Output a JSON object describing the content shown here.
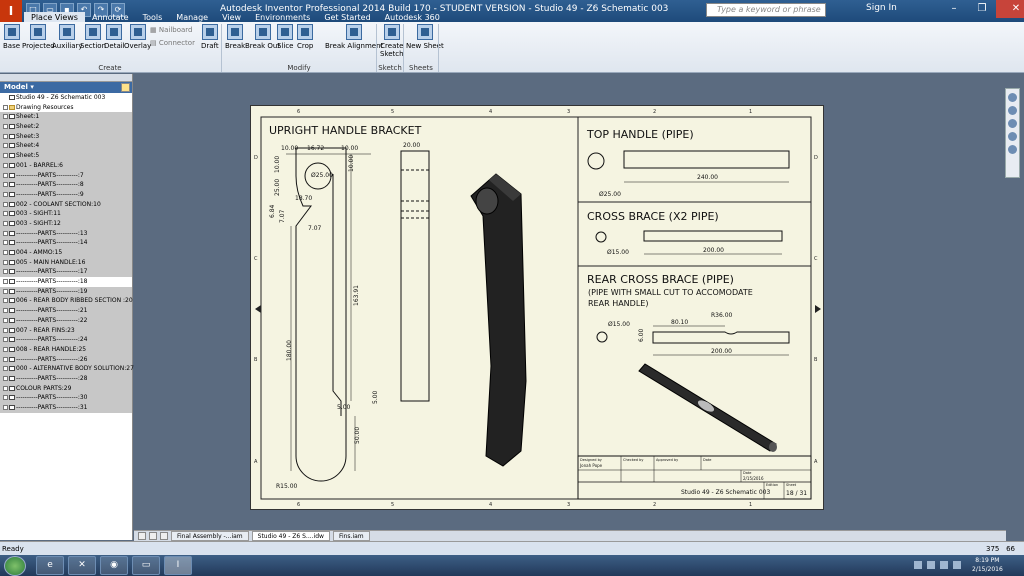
{
  "window": {
    "title": "Autodesk Inventor Professional 2014 Build 170 - STUDENT VERSION  - Studio 49 - Z6 Schematic 003",
    "app_letter": "I",
    "search_placeholder": "Type a keyword or phrase",
    "sign_in": "Sign In"
  },
  "tabs": [
    "Place Views",
    "Annotate",
    "Tools",
    "Manage",
    "View",
    "Environments",
    "Get Started",
    "Autodesk 360"
  ],
  "active_tab": "Place Views",
  "ribbon": {
    "create": {
      "buttons": [
        "Base",
        "Projected",
        "Auxiliary",
        "Section",
        "Detail",
        "Overlay"
      ],
      "small": [
        "Nailboard",
        "Connector"
      ],
      "label": "Create"
    },
    "modify": {
      "buttons": [
        "Draft",
        "Break",
        "Break Out",
        "Slice",
        "Crop",
        "Break Alignment"
      ],
      "label": "Modify"
    },
    "sketch": {
      "button_line1": "Create",
      "button_line2": "Sketch",
      "label": "Sketch"
    },
    "sheets": {
      "button": "New Sheet",
      "label": "Sheets"
    }
  },
  "browser": {
    "title": "Model",
    "rows": [
      {
        "label": "Studio 49 - Z6 Schematic 003",
        "icon": "drawing-icon",
        "sel": false,
        "exp": false
      },
      {
        "label": "Drawing Resources",
        "icon": "folder-icon",
        "sel": false,
        "exp": true
      },
      {
        "label": "Sheet:1",
        "icon": "sheet-icon",
        "sel": true,
        "exp": true
      },
      {
        "label": "Sheet:2",
        "icon": "sheet-icon",
        "sel": true,
        "exp": true
      },
      {
        "label": "Sheet:3",
        "icon": "sheet-icon",
        "sel": true,
        "exp": true
      },
      {
        "label": "Sheet:4",
        "icon": "sheet-icon",
        "sel": true,
        "exp": true
      },
      {
        "label": "Sheet:5",
        "icon": "sheet-icon",
        "sel": true,
        "exp": true
      },
      {
        "label": "001 - BARREL:6",
        "icon": "sheet-icon",
        "sel": true,
        "exp": true
      },
      {
        "label": "----------PARTS----------:7",
        "icon": "sheet-icon",
        "sel": true,
        "exp": true
      },
      {
        "label": "----------PARTS----------:8",
        "icon": "sheet-icon",
        "sel": true,
        "exp": true
      },
      {
        "label": "----------PARTS----------:9",
        "icon": "sheet-icon",
        "sel": true,
        "exp": true
      },
      {
        "label": "002 - COOLANT SECTION:10",
        "icon": "sheet-icon",
        "sel": true,
        "exp": true
      },
      {
        "label": "003 - SIGHT:11",
        "icon": "sheet-icon",
        "sel": true,
        "exp": true
      },
      {
        "label": "003 - SIGHT:12",
        "icon": "sheet-icon",
        "sel": true,
        "exp": true
      },
      {
        "label": "----------PARTS----------:13",
        "icon": "sheet-icon",
        "sel": true,
        "exp": true
      },
      {
        "label": "----------PARTS----------:14",
        "icon": "sheet-icon",
        "sel": true,
        "exp": true
      },
      {
        "label": "004 - AMMO:15",
        "icon": "sheet-icon",
        "sel": true,
        "exp": true
      },
      {
        "label": "005 - MAIN HANDLE:16",
        "icon": "sheet-icon",
        "sel": true,
        "exp": true
      },
      {
        "label": "----------PARTS----------:17",
        "icon": "sheet-icon",
        "sel": true,
        "exp": true
      },
      {
        "label": "----------PARTS----------:18",
        "icon": "sheet-icon",
        "sel": false,
        "exp": true
      },
      {
        "label": "----------PARTS----------:19",
        "icon": "sheet-icon",
        "sel": true,
        "exp": true
      },
      {
        "label": "006 - REAR BODY RIBBED SECTION :20",
        "icon": "sheet-icon",
        "sel": true,
        "exp": true
      },
      {
        "label": "----------PARTS----------:21",
        "icon": "sheet-icon",
        "sel": true,
        "exp": true
      },
      {
        "label": "----------PARTS----------:22",
        "icon": "sheet-icon",
        "sel": true,
        "exp": true
      },
      {
        "label": "007 - REAR FINS:23",
        "icon": "sheet-icon",
        "sel": true,
        "exp": true
      },
      {
        "label": "----------PARTS----------:24",
        "icon": "sheet-icon",
        "sel": true,
        "exp": true
      },
      {
        "label": "008 - REAR HANDLE:25",
        "icon": "sheet-icon",
        "sel": true,
        "exp": true
      },
      {
        "label": "----------PARTS----------:26",
        "icon": "sheet-icon",
        "sel": true,
        "exp": true
      },
      {
        "label": "000 - ALTERNATIVE BODY SOLUTION:27",
        "icon": "sheet-icon",
        "sel": true,
        "exp": true
      },
      {
        "label": "----------PARTS----------:28",
        "icon": "sheet-icon",
        "sel": true,
        "exp": true
      },
      {
        "label": "COLOUR PARTS:29",
        "icon": "sheet-icon",
        "sel": true,
        "exp": true
      },
      {
        "label": "----------PARTS----------:30",
        "icon": "sheet-icon",
        "sel": true,
        "exp": true
      },
      {
        "label": "----------PARTS----------:31",
        "icon": "sheet-icon",
        "sel": true,
        "exp": true
      }
    ]
  },
  "drawing": {
    "title_left": "UPRIGHT HANDLE BRACKET",
    "title_top": "TOP HANDLE (PIPE)",
    "title_cross": "CROSS BRACE (X2 PIPE)",
    "title_rear": "REAR CROSS BRACE (PIPE)",
    "rear_note_1": "(PIPE WITH SMALL CUT TO ACCOMODATE",
    "rear_note_2": "REAR HANDLE)",
    "dims": {
      "d1": "10.00",
      "d2": "16.72",
      "d3": "10.00",
      "d4": "20.00",
      "d5": "10.00",
      "d6": "Ø25.00",
      "d7": "25.00",
      "d8": "18.70",
      "d9": "6.84",
      "d10": "7.07",
      "d11": "7.07",
      "d12": "163.91",
      "d13": "180.00",
      "d14": "5.00",
      "d15": "5.00",
      "d16": "50.00",
      "d17": "R15.00",
      "top_dia": "Ø25.00",
      "top_len": "240.00",
      "cross_dia": "Ø15.00",
      "cross_len": "200.00",
      "rear_dia": "Ø15.00",
      "rear_80": "80.10",
      "rear_r": "R36.00",
      "rear_6": "6.00",
      "rear_len": "200.00"
    },
    "col_labels": [
      "6",
      "5",
      "4",
      "3",
      "2",
      "1"
    ],
    "row_labels": [
      "D",
      "C",
      "B",
      "A"
    ],
    "titleblock": {
      "designed_by_h": "Designed by",
      "designed_by": "Jonah Pope",
      "checked_by_h": "Checked by",
      "approved_by_h": "Approved by",
      "date_h": "Date",
      "date_label": "Date",
      "date": "2/15/2016",
      "name": "Studio 49 - Z6 Schematic 003",
      "edition_h": "Edition",
      "sheet_h": "Sheet",
      "sheet": "18 / 31"
    }
  },
  "doc_tabs": [
    "Final Assembly -...iam",
    "Studio 49 - Z6 S....idw",
    "Fins.iam"
  ],
  "active_doc": 1,
  "status": {
    "text": "Ready",
    "n1": "375",
    "n2": "66"
  },
  "taskbar": {
    "time": "8:19 PM",
    "date": "2/15/2016",
    "active_app": "Inventor"
  },
  "colors": {
    "accent": "#2f5f92",
    "sheet": "#f5f4e1",
    "canvas": "#5b6b80"
  }
}
